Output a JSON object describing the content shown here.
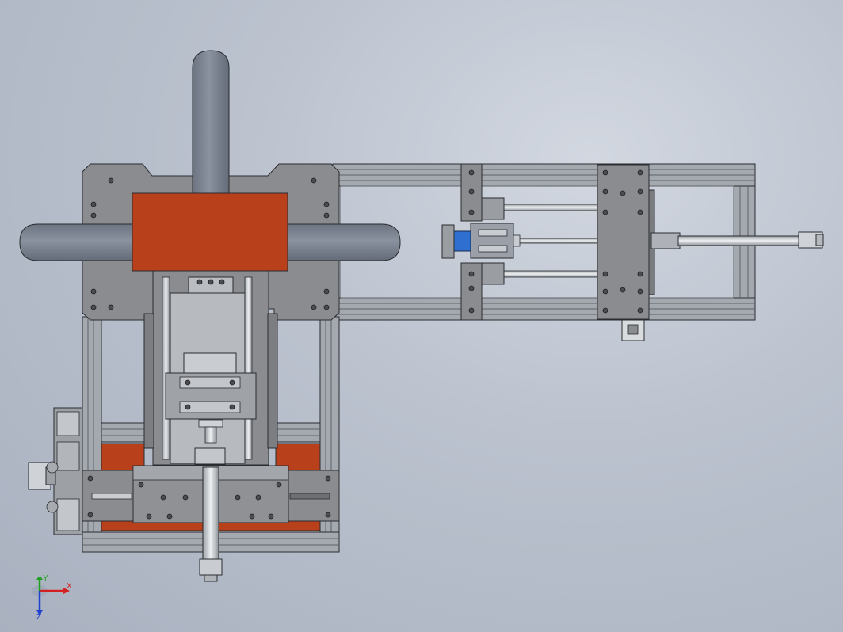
{
  "viewport": {
    "background": "#bcc3cf",
    "colors": {
      "plate": "#8a8c8f",
      "plate_dark": "#6d6f72",
      "rail": "#a4a9b0",
      "rail_dark": "#5e6167",
      "tube": "#7d8492",
      "orange": "#b8411c",
      "shaft": "#cfd2d6",
      "blue": "#2f6fd0",
      "outline": "#2a2c30"
    }
  },
  "triad": {
    "x_label": "X",
    "y_label": "Y",
    "z_label": "Z",
    "x_color": "#d42020",
    "y_color": "#20a020",
    "z_color": "#2040d0"
  }
}
